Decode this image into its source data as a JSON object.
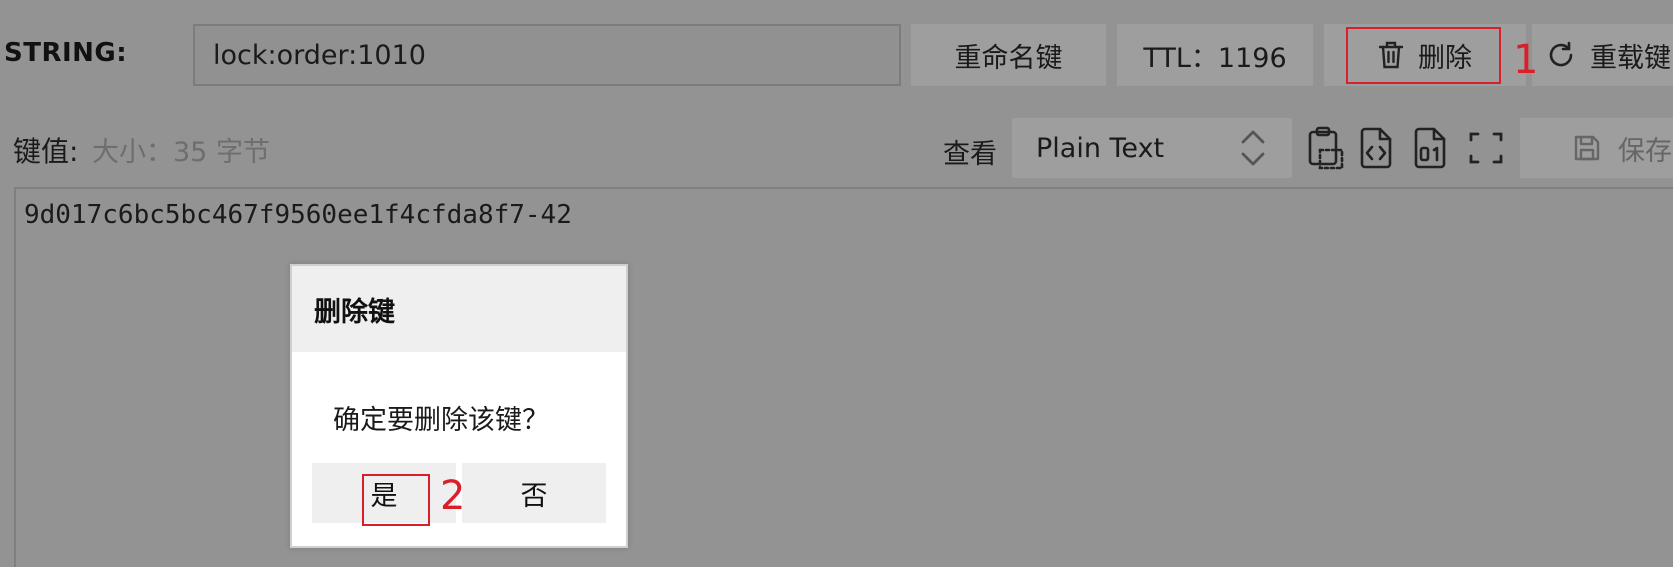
{
  "header": {
    "type_label": "STRING:",
    "key_value": "lock:order:1010",
    "rename_label": "重命名键",
    "ttl_label": "TTL：1196",
    "delete_label": "删除",
    "reload_label": "重载键"
  },
  "value_bar": {
    "value_label": "键值:",
    "size_info": "大小：35 字节",
    "view_label": "查看",
    "view_format": "Plain Text",
    "save_label": "保存"
  },
  "value_content": "9d017c6bc5bc467f9560ee1f4cfda8f7-42",
  "dialog": {
    "title": "删除键",
    "message": "确定要删除该键？",
    "yes_label": "是",
    "no_label": "否"
  },
  "annotations": {
    "step1": "1",
    "step2": "2",
    "color": "#d9202a"
  },
  "icons": [
    "trash-icon",
    "reload-icon",
    "select-arrows-icon",
    "copy-icon",
    "code-file-icon",
    "binary-file-icon",
    "expand-icon",
    "save-icon"
  ]
}
